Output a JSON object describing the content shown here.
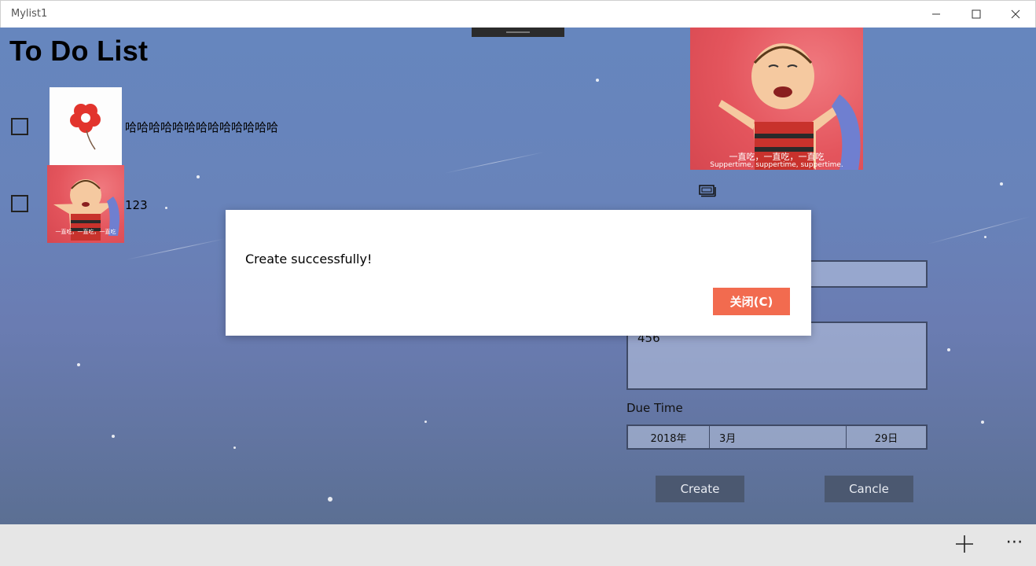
{
  "window": {
    "title": "Mylist1"
  },
  "page": {
    "title": "To Do List"
  },
  "todos": [
    {
      "text": "哈哈哈哈哈哈哈哈哈哈哈哈哈",
      "checked": false,
      "image": "red-flower"
    },
    {
      "text": "123",
      "checked": false,
      "image": "linus-cartoon"
    }
  ],
  "editor": {
    "image_caption_cn": "一直吃，一直吃，一直吃",
    "image_caption_en": "Suppertime, suppertime, suppertime.",
    "title_value": "",
    "detail_value": "456",
    "due_label": "Due Time",
    "date": {
      "year": "2018年",
      "month": "3月",
      "day": "29日"
    },
    "create_label": "Create",
    "cancel_label": "Cancle"
  },
  "thumb_caption": "一直吃，一直吃，一直吃",
  "dialog": {
    "message": "Create successfully!",
    "close_label": "关闭(C)"
  },
  "colors": {
    "accent": "#f26b4f",
    "button": "#4b5870"
  }
}
